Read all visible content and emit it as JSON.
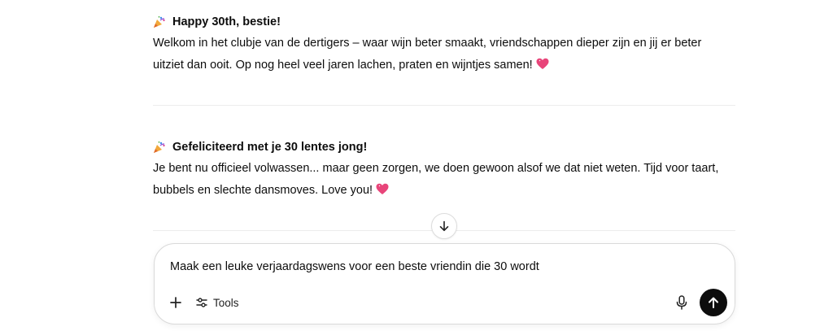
{
  "messages": [
    {
      "title": "Happy 30th, bestie!",
      "body": "Welkom in het clubje van de dertigers – waar wijn beter smaakt, vriendschappen dieper zijn en jij er beter uitziet dan ooit. Op nog heel veel jaren lachen, praten en wijntjes samen!"
    },
    {
      "title": "Gefeliciteerd met je 30 lentes jong!",
      "body": "Je bent nu officieel volwassen... maar geen zorgen, we doen gewoon alsof we dat niet weten. Tijd voor taart, bubbels en slechte dansmoves. Love you!"
    }
  ],
  "composer": {
    "input_value": "Maak een leuke verjaardagswens voor een beste vriendin die 30 wordt",
    "tools_label": "Tools"
  },
  "icons": {
    "party": "party-popper-icon",
    "heart": "sparkling-heart-icon",
    "scroll": "arrow-down-icon",
    "plus": "plus-icon",
    "tools": "sliders-icon",
    "mic": "microphone-icon",
    "send": "arrow-up-icon"
  },
  "colors": {
    "send_button": "#0d0d0d",
    "heart": "#e8457a"
  }
}
